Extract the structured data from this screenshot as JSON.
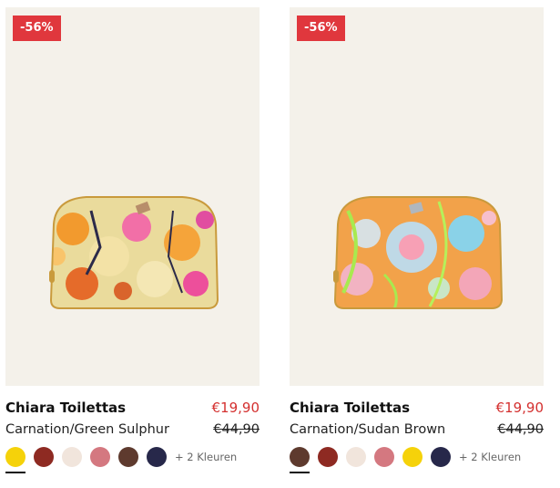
{
  "products": [
    {
      "badge": "-56%",
      "name": "Chiara Toilettas",
      "price": "€19,90",
      "color": "Carnation/Green Sulphur",
      "old_price": "€44,90",
      "swatches": [
        "#f5d20a",
        "#8e2a22",
        "#f1e5dc",
        "#d47880",
        "#5e3a2e",
        "#27284a"
      ],
      "more_colors": "+ 2 Kleuren"
    },
    {
      "badge": "-56%",
      "name": "Chiara Toilettas",
      "price": "€19,90",
      "color": "Carnation/Sudan Brown",
      "old_price": "€44,90",
      "swatches": [
        "#5e3a2e",
        "#8e2a22",
        "#f1e5dc",
        "#d47880",
        "#f5d20a",
        "#27284a"
      ],
      "more_colors": "+ 2 Kleuren"
    }
  ]
}
